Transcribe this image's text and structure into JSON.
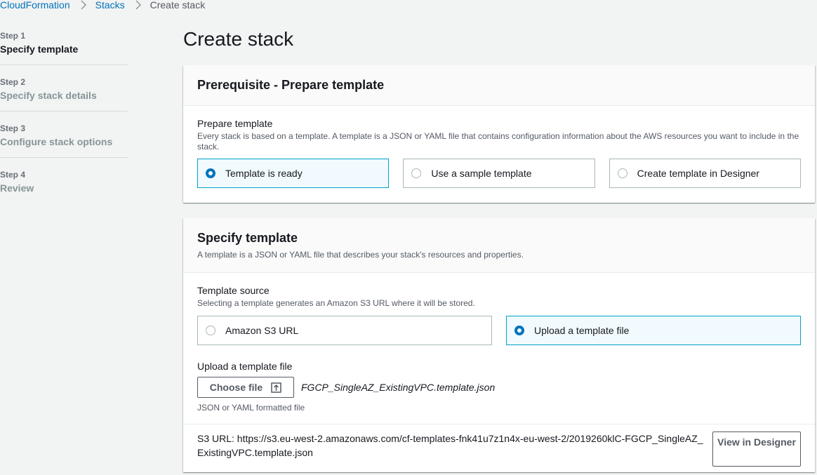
{
  "breadcrumb": {
    "items": [
      "CloudFormation",
      "Stacks"
    ],
    "current": "Create stack"
  },
  "steps": [
    {
      "num": "Step 1",
      "title": "Specify template"
    },
    {
      "num": "Step 2",
      "title": "Specify stack details"
    },
    {
      "num": "Step 3",
      "title": "Configure stack options"
    },
    {
      "num": "Step 4",
      "title": "Review"
    }
  ],
  "page": {
    "title": "Create stack"
  },
  "prerequisite": {
    "header": "Prerequisite - Prepare template",
    "label": "Prepare template",
    "description": "Every stack is based on a template. A template is a JSON or YAML file that contains configuration information about the AWS resources you want to include in the stack.",
    "options": [
      "Template is ready",
      "Use a sample template",
      "Create template in Designer"
    ],
    "selected": "Template is ready"
  },
  "specify": {
    "header": "Specify template",
    "header_desc": "A template is a JSON or YAML file that describes your stack's resources and properties.",
    "source_label": "Template source",
    "source_desc": "Selecting a template generates an Amazon S3 URL where it will be stored.",
    "options": [
      "Amazon S3 URL",
      "Upload a template file"
    ],
    "selected": "Upload a template file",
    "upload_label": "Upload a template file",
    "choose_button": "Choose file",
    "file_name": "FGCP_SingleAZ_ExistingVPC.template.json",
    "file_hint": "JSON or YAML formatted file",
    "s3_url_text": "S3 URL:  https://s3.eu-west-2.amazonaws.com/cf-templates-fnk41u7z1n4x-eu-west-2/2019260klC-FGCP_SingleAZ_ExistingVPC.template.json",
    "view_button": "View in Designer"
  },
  "colors": {
    "link": "#0073bb",
    "selected_border": "#00a1c9",
    "selected_bg": "#f1faff"
  },
  "icons": [
    "chevron-right-icon",
    "upload-icon"
  ]
}
